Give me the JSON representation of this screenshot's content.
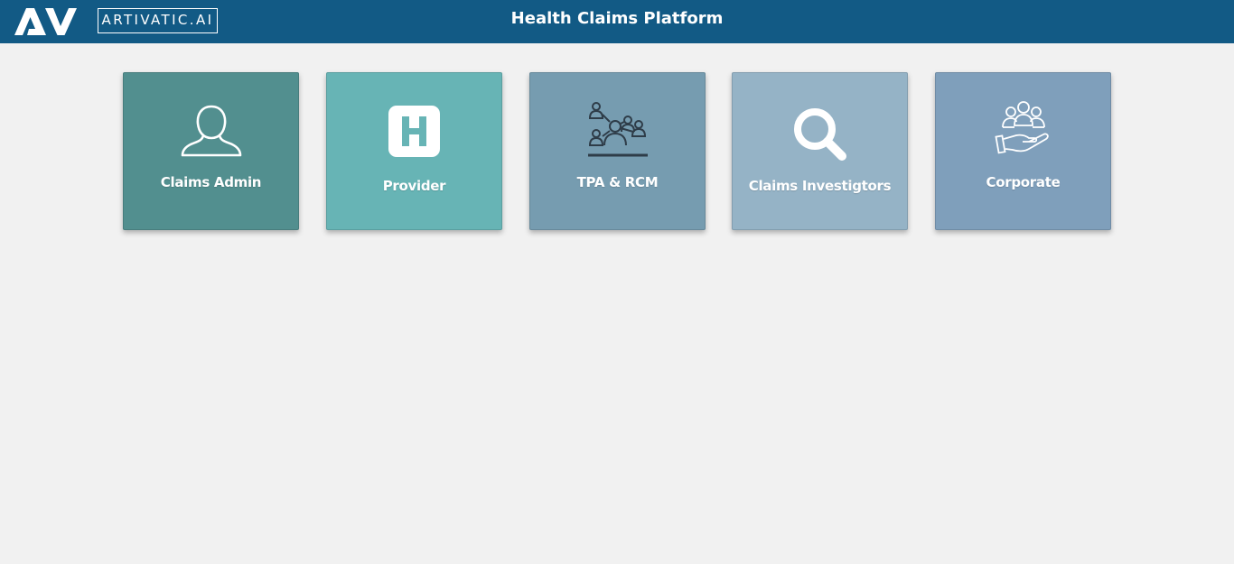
{
  "header": {
    "logo_mark": "AV",
    "logo_text": "ARTIVATIC.AI",
    "title": "Health Claims Platform",
    "background_color": "#125a85"
  },
  "tiles": [
    {
      "label": "Claims Admin",
      "icon": "user-outline-icon",
      "color": "#528f8f"
    },
    {
      "label": "Provider",
      "icon": "hospital-h-icon",
      "color": "#67b4b5"
    },
    {
      "label": "TPA & RCM",
      "icon": "people-network-icon",
      "color": "#769cb0"
    },
    {
      "label": "Claims Investigtors",
      "icon": "magnifier-icon",
      "color": "#95b3c6"
    },
    {
      "label": "Corporate",
      "icon": "group-in-hand-icon",
      "color": "#7f9fbb"
    }
  ]
}
